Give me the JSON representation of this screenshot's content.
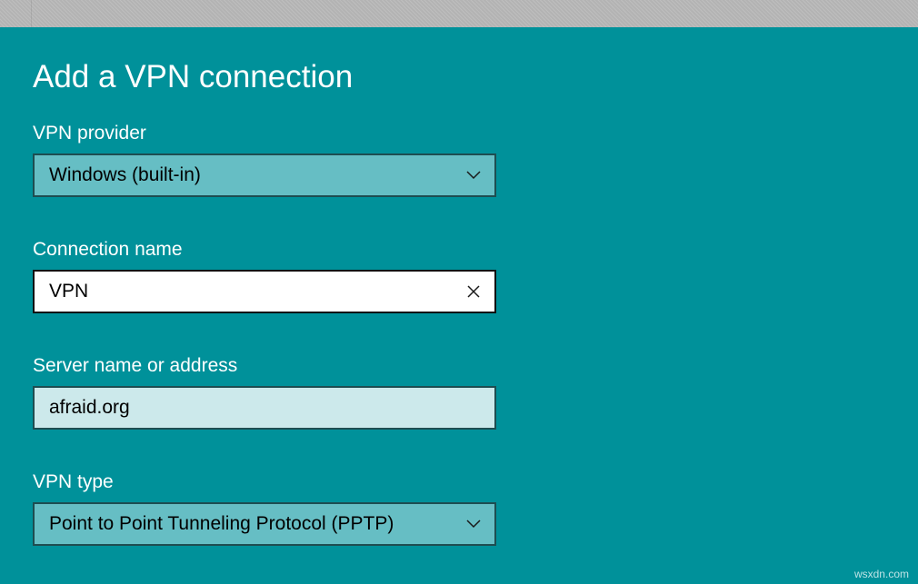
{
  "dialog": {
    "title": "Add a VPN connection"
  },
  "fields": {
    "vpn_provider": {
      "label": "VPN provider",
      "value": "Windows (built-in)"
    },
    "connection_name": {
      "label": "Connection name",
      "value": "VPN"
    },
    "server": {
      "label": "Server name or address",
      "value": "afraid.org"
    },
    "vpn_type": {
      "label": "VPN type",
      "value": "Point to Point Tunneling Protocol (PPTP)"
    }
  },
  "icons": {
    "dropdown": "chevron-down-icon",
    "clear": "close-icon"
  },
  "colors": {
    "background": "#00919a",
    "select_fill": "#66bec4",
    "input_idle_fill": "#cce9eb",
    "border": "#1e4d51"
  },
  "watermark": "wsxdn.com"
}
